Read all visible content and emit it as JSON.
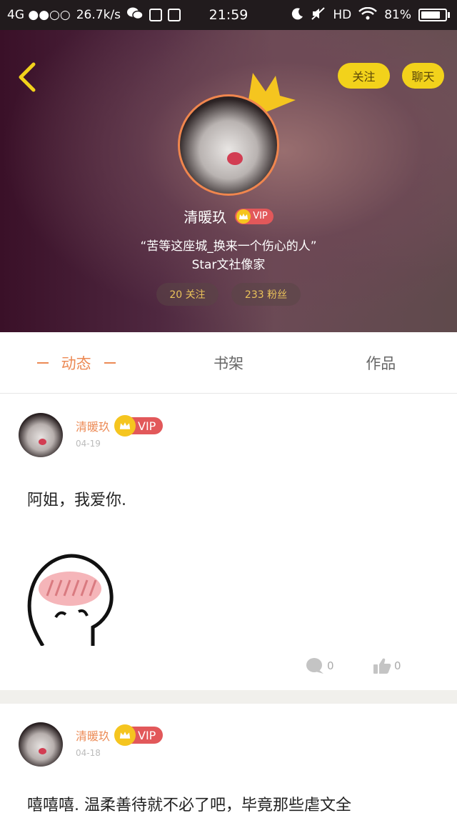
{
  "status_bar": {
    "network": "4G ●●○○",
    "speed": "26.7k/s",
    "time": "21:59",
    "hd": "HD",
    "battery": "81%",
    "battery_level": 0.81
  },
  "header": {
    "follow_label": "关注",
    "chat_label": "聊天",
    "username": "清暖玖",
    "vip_label": "VIP",
    "signature": "“苦等这座城_换来一个伤心的人”",
    "org": "Star文社像家",
    "following_stat": "20 关注",
    "fans_stat": "233 粉丝"
  },
  "tabs": [
    {
      "label": "动态",
      "active": true
    },
    {
      "label": "书架",
      "active": false
    },
    {
      "label": "作品",
      "active": false
    }
  ],
  "posts": [
    {
      "username": "清暖玖",
      "vip": "VIP",
      "date": "04-19",
      "text": "阿姐，我爱你.",
      "comments": "0",
      "likes": "0"
    },
    {
      "username": "清暖玖",
      "vip": "VIP",
      "date": "04-18",
      "text": "嘻嘻嘻. 温柔善待就不必了吧，毕竟那些虐文全"
    }
  ]
}
